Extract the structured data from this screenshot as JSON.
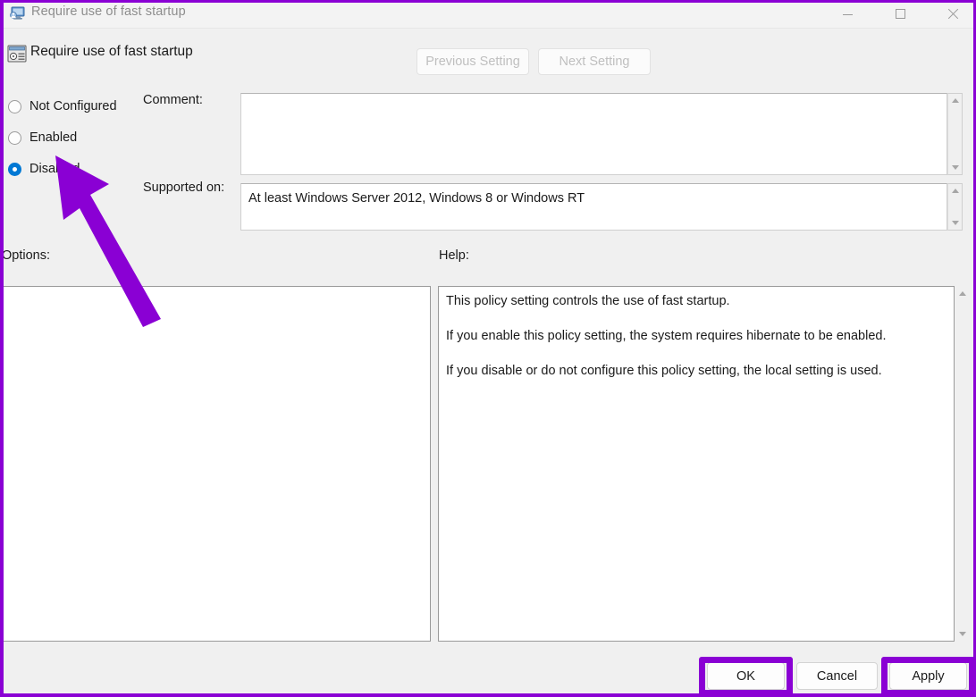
{
  "window": {
    "title": "Require use of fast startup",
    "title_icon": "policy-monitor-icon",
    "controls": {
      "minimize": "minimize-icon",
      "maximize": "maximize-icon",
      "close": "close-icon"
    }
  },
  "header": {
    "icon": "policy-setting-icon",
    "title": "Require use of fast startup"
  },
  "nav": {
    "previous_label": "Previous Setting",
    "next_label": "Next Setting"
  },
  "state_options": [
    {
      "label": "Not Configured",
      "selected": false
    },
    {
      "label": "Enabled",
      "selected": false
    },
    {
      "label": "Disabled",
      "selected": true
    }
  ],
  "fields": {
    "comment_label": "Comment:",
    "comment_value": "",
    "supported_label": "Supported on:",
    "supported_value": "At least Windows Server 2012, Windows 8 or Windows RT"
  },
  "panels": {
    "options_label": "Options:",
    "help_label": "Help:",
    "help_paragraphs": [
      "This policy setting controls the use of fast startup.",
      "If you enable this policy setting, the system requires hibernate to be enabled.",
      "If you disable or do not configure this policy setting, the local setting is used."
    ]
  },
  "buttons": {
    "ok": "OK",
    "cancel": "Cancel",
    "apply": "Apply"
  },
  "annotations": {
    "color": "#8a00d4",
    "arrow_target": "Disabled radio option",
    "highlighted_buttons": [
      "OK",
      "Apply"
    ]
  }
}
